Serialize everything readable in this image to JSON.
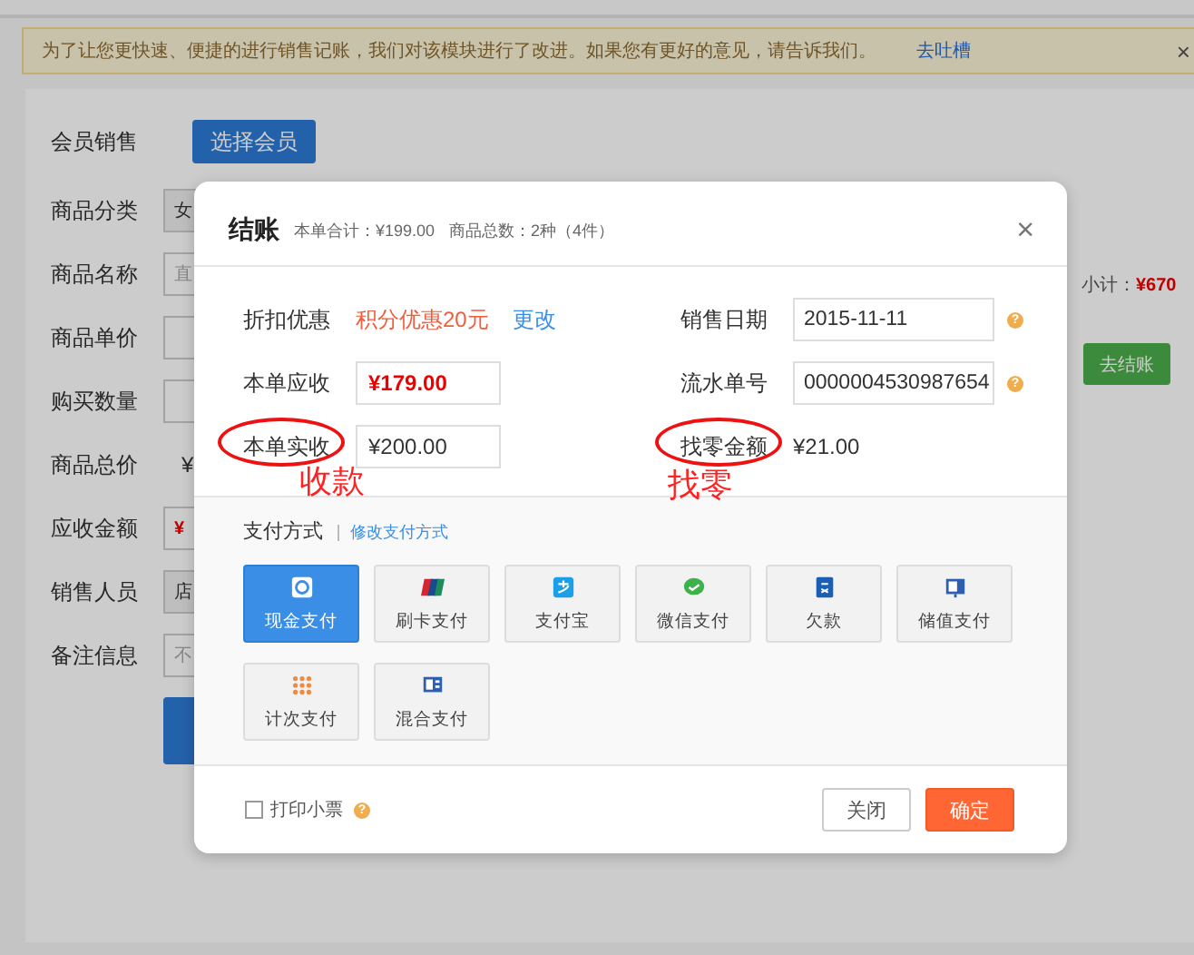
{
  "notice": {
    "text": "为了让您更快速、便捷的进行销售记账，我们对该模块进行了改进。如果您有更好的意见，请告诉我们。",
    "link": "去吐槽",
    "close": "×"
  },
  "member": {
    "label": "会员销售",
    "button": "选择会员"
  },
  "form": [
    {
      "label": "商品分类",
      "kind": "select",
      "value": "女"
    },
    {
      "label": "商品名称",
      "kind": "input",
      "placeholder": "直"
    },
    {
      "label": "商品单价",
      "kind": "input"
    },
    {
      "label": "购买数量",
      "kind": "input"
    },
    {
      "label": "商品总价",
      "kind": "text",
      "value": "¥"
    },
    {
      "label": "应收金额",
      "kind": "input",
      "value": "¥",
      "emphasis": true
    },
    {
      "label": "销售人员",
      "kind": "select",
      "value": "店"
    },
    {
      "label": "备注信息",
      "kind": "input",
      "placeholder": "不"
    }
  ],
  "form_button": {
    "kind": "primary"
  },
  "subtotal": {
    "label": "小计：",
    "amount": "¥670"
  },
  "checkout_button": "去结账",
  "dialog": {
    "title": "结账",
    "total": "本单合计：¥199.00",
    "count": "商品总数：2种（4件）",
    "close": "×",
    "fields": [
      {
        "label": "折扣优惠",
        "kind": "discount",
        "value": "积分优惠20元",
        "link": "更改"
      },
      {
        "label": "销售日期",
        "kind": "input",
        "value": "2015-11-11",
        "help": "?"
      },
      {
        "label": "本单应收",
        "kind": "input",
        "value": "¥179.00",
        "emphasis": true
      },
      {
        "label": "流水单号",
        "kind": "input",
        "value": "0000004530987654",
        "help": "?"
      },
      {
        "label": "本单实收",
        "kind": "input",
        "value": "¥200.00",
        "circled": true,
        "note": "收款"
      },
      {
        "label": "找零金额",
        "kind": "text",
        "value": "¥21.00",
        "circled": true,
        "note": "找零"
      }
    ],
    "payment": {
      "label": "支付方式",
      "link": "修改支付方式",
      "methods": [
        {
          "label": "现金支付",
          "kind": "cash",
          "selected": true
        },
        {
          "label": "刷卡支付",
          "kind": "card",
          "selected": false
        },
        {
          "label": "支付宝",
          "kind": "alipay",
          "selected": false
        },
        {
          "label": "微信支付",
          "kind": "chat",
          "selected": false
        },
        {
          "label": "欠款",
          "kind": "debt",
          "selected": false
        },
        {
          "label": "储值支付",
          "kind": "stored",
          "selected": false
        },
        {
          "label": "计次支付",
          "kind": "dots",
          "selected": false
        },
        {
          "label": "混合支付",
          "kind": "mixed",
          "selected": false
        }
      ]
    },
    "print": {
      "label": "打印小票",
      "checked": false,
      "help": "?"
    },
    "buttons": [
      {
        "label": "关闭",
        "kind": "default"
      },
      {
        "label": "确定",
        "kind": "primary"
      }
    ]
  }
}
